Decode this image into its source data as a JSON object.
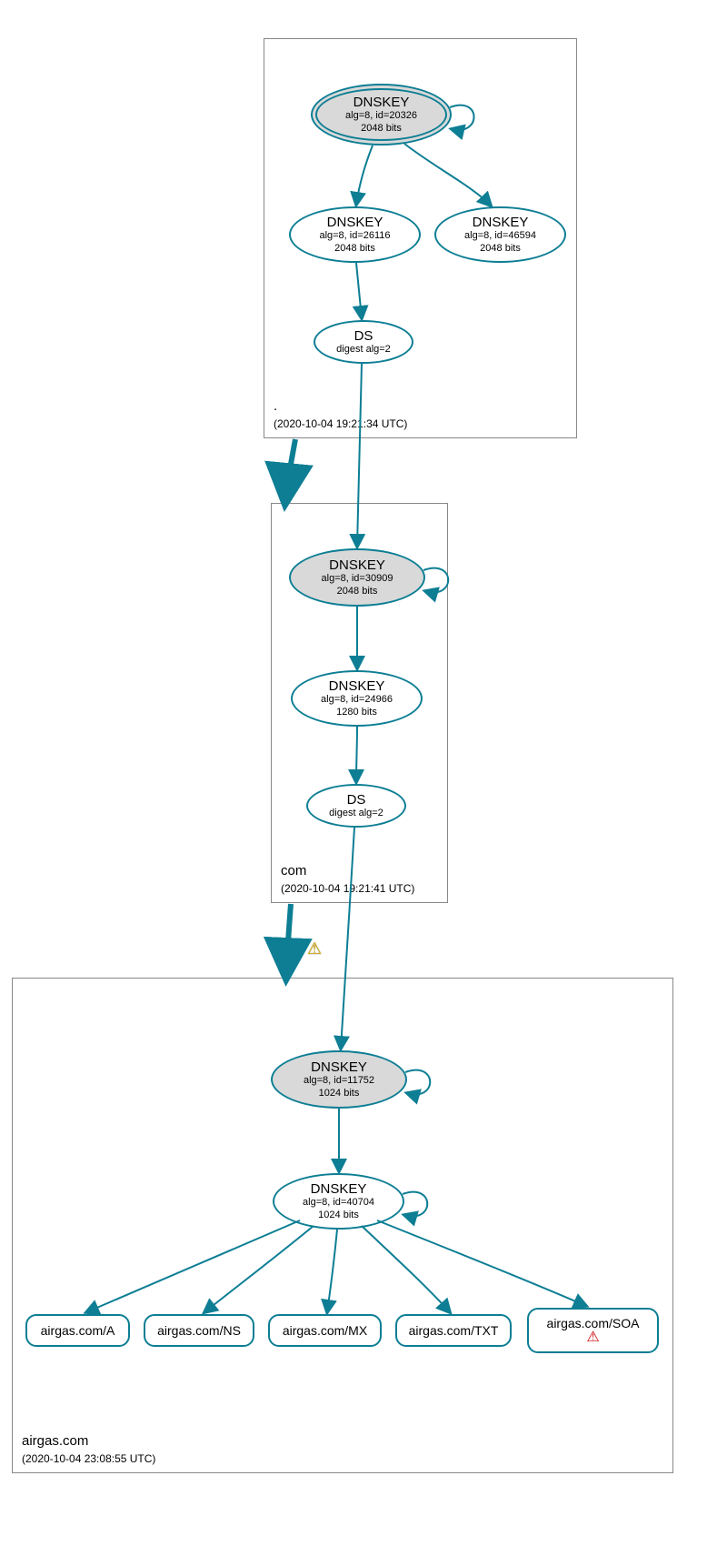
{
  "diagram_type": "DNSSEC authentication chain",
  "colors": {
    "stroke": "#0d7e94",
    "fill_ksk": "#d9d9d9"
  },
  "zones": {
    "root": {
      "name": ".",
      "timestamp": "(2020-10-04 19:21:34 UTC)",
      "nodes": {
        "ksk": {
          "title": "DNSKEY",
          "line1": "alg=8, id=20326",
          "line2": "2048 bits"
        },
        "zsk": {
          "title": "DNSKEY",
          "line1": "alg=8, id=26116",
          "line2": "2048 bits"
        },
        "standby": {
          "title": "DNSKEY",
          "line1": "alg=8, id=46594",
          "line2": "2048 bits"
        },
        "ds": {
          "title": "DS",
          "line1": "digest alg=2"
        }
      }
    },
    "com": {
      "name": "com",
      "timestamp": "(2020-10-04 19:21:41 UTC)",
      "nodes": {
        "ksk": {
          "title": "DNSKEY",
          "line1": "alg=8, id=30909",
          "line2": "2048 bits"
        },
        "zsk": {
          "title": "DNSKEY",
          "line1": "alg=8, id=24966",
          "line2": "1280 bits"
        },
        "ds": {
          "title": "DS",
          "line1": "digest alg=2"
        }
      }
    },
    "airgas": {
      "name": "airgas.com",
      "timestamp": "(2020-10-04 23:08:55 UTC)",
      "nodes": {
        "ksk": {
          "title": "DNSKEY",
          "line1": "alg=8, id=11752",
          "line2": "1024 bits"
        },
        "zsk": {
          "title": "DNSKEY",
          "line1": "alg=8, id=40704",
          "line2": "1024 bits"
        }
      },
      "rrsets": {
        "a": "airgas.com/A",
        "ns": "airgas.com/NS",
        "mx": "airgas.com/MX",
        "txt": "airgas.com/TXT",
        "soa": "airgas.com/SOA"
      }
    }
  },
  "delegations": [
    {
      "from": "root",
      "to": "com",
      "warning": false
    },
    {
      "from": "com",
      "to": "airgas",
      "warning": true
    }
  ],
  "warnings": {
    "delegation_com_airgas": "warning",
    "soa_error": "error"
  }
}
